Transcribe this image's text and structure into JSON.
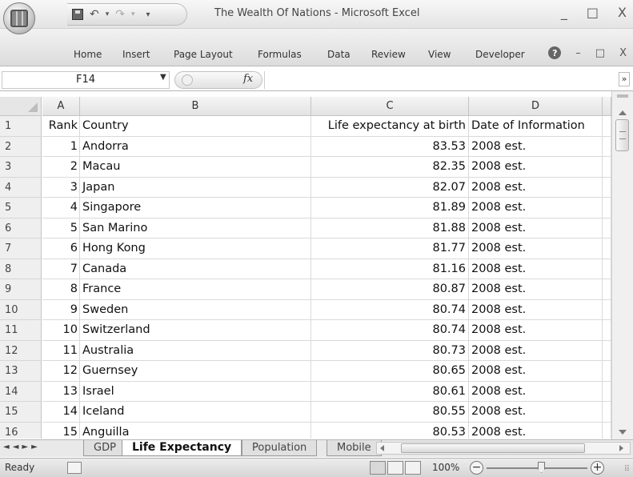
{
  "window": {
    "title": "The Wealth Of Nations - Microsoft Excel",
    "controls": [
      "_",
      "□",
      "X"
    ]
  },
  "ribbon": {
    "tabs": [
      "Home",
      "Insert",
      "Page Layout",
      "Formulas",
      "Data",
      "Review",
      "View",
      "Developer"
    ],
    "right_controls": [
      "–",
      "□",
      "X"
    ]
  },
  "formula_bar": {
    "name_box": "F14",
    "fx_label": "fx",
    "formula": ""
  },
  "sheet": {
    "columns": [
      "A",
      "B",
      "C",
      "D"
    ],
    "rows": [
      {
        "num": "1",
        "a": "Rank",
        "b": "Country",
        "c": "Life expectancy at birth",
        "d": "Date of Information"
      },
      {
        "num": "2",
        "a": "1",
        "b": "Andorra",
        "c": "83.53",
        "d": "2008 est."
      },
      {
        "num": "3",
        "a": "2",
        "b": "Macau",
        "c": "82.35",
        "d": "2008 est."
      },
      {
        "num": "4",
        "a": "3",
        "b": "Japan",
        "c": "82.07",
        "d": "2008 est."
      },
      {
        "num": "5",
        "a": "4",
        "b": "Singapore",
        "c": "81.89",
        "d": "2008 est."
      },
      {
        "num": "6",
        "a": "5",
        "b": "San Marino",
        "c": "81.88",
        "d": "2008 est."
      },
      {
        "num": "7",
        "a": "6",
        "b": "Hong Kong",
        "c": "81.77",
        "d": "2008 est."
      },
      {
        "num": "8",
        "a": "7",
        "b": "Canada",
        "c": "81.16",
        "d": "2008 est."
      },
      {
        "num": "9",
        "a": "8",
        "b": "France",
        "c": "80.87",
        "d": "2008 est."
      },
      {
        "num": "10",
        "a": "9",
        "b": "Sweden",
        "c": "80.74",
        "d": "2008 est."
      },
      {
        "num": "11",
        "a": "10",
        "b": "Switzerland",
        "c": "80.74",
        "d": "2008 est."
      },
      {
        "num": "12",
        "a": "11",
        "b": "Australia",
        "c": "80.73",
        "d": "2008 est."
      },
      {
        "num": "13",
        "a": "12",
        "b": "Guernsey",
        "c": "80.65",
        "d": "2008 est."
      },
      {
        "num": "14",
        "a": "13",
        "b": "Israel",
        "c": "80.61",
        "d": "2008 est."
      },
      {
        "num": "15",
        "a": "14",
        "b": "Iceland",
        "c": "80.55",
        "d": "2008 est."
      },
      {
        "num": "16",
        "a": "15",
        "b": "Anguilla",
        "c": "80.53",
        "d": "2008 est."
      }
    ]
  },
  "sheet_tabs": [
    "GDP",
    "Life Expectancy",
    "Population",
    "Mobile"
  ],
  "active_sheet": "Life Expectancy",
  "status": {
    "text": "Ready",
    "zoom": "100%"
  },
  "colors": {
    "chrome": "#e4e4e4",
    "grid_line": "#dadada",
    "header_bg": "#efefef"
  }
}
